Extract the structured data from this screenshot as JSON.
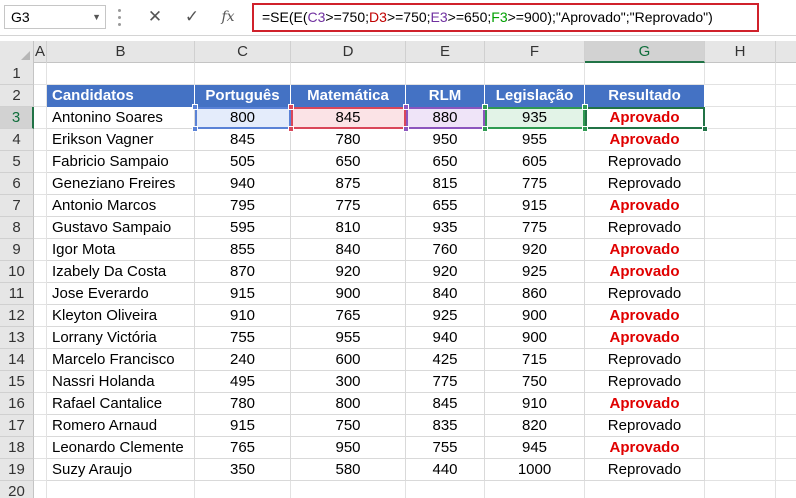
{
  "formula_bar": {
    "name_box": "G3",
    "cancel_icon": "✕",
    "enter_icon": "✓",
    "fx_label": "fx",
    "formula_parts": [
      {
        "text": "=SE(E(",
        "color": "#000000"
      },
      {
        "text": "C3",
        "color": "#7030a0"
      },
      {
        "text": ">=750;",
        "color": "#000000"
      },
      {
        "text": "D3",
        "color": "#c00000"
      },
      {
        "text": ">=750;",
        "color": "#000000"
      },
      {
        "text": "E3",
        "color": "#7030a0"
      },
      {
        "text": ">=650;",
        "color": "#000000"
      },
      {
        "text": "F3",
        "color": "#00a000"
      },
      {
        "text": ">=900);\"Aprovado\";\"Reprovado\")",
        "color": "#000000"
      }
    ]
  },
  "columns": [
    "A",
    "B",
    "C",
    "D",
    "E",
    "F",
    "G",
    "H"
  ],
  "rows": [
    "1",
    "2",
    "3",
    "4",
    "5",
    "6",
    "7",
    "8",
    "9",
    "10",
    "11",
    "12",
    "13",
    "14",
    "15",
    "16",
    "17",
    "18",
    "19",
    "20"
  ],
  "selected_cell": {
    "column": "G",
    "row": "3"
  },
  "table": {
    "headers": [
      "Candidatos",
      "Português",
      "Matemática",
      "RLM",
      "Legislação",
      "Resultado"
    ],
    "rows": [
      [
        "Antonino Soares",
        "800",
        "845",
        "880",
        "935",
        "Aprovado"
      ],
      [
        "Erikson Vagner",
        "845",
        "780",
        "950",
        "955",
        "Aprovado"
      ],
      [
        "Fabricio Sampaio",
        "505",
        "650",
        "650",
        "605",
        "Reprovado"
      ],
      [
        "Geneziano Freires",
        "940",
        "875",
        "815",
        "775",
        "Reprovado"
      ],
      [
        "Antonio Marcos",
        "795",
        "775",
        "655",
        "915",
        "Aprovado"
      ],
      [
        "Gustavo Sampaio",
        "595",
        "810",
        "935",
        "775",
        "Reprovado"
      ],
      [
        "Igor Mota",
        "855",
        "840",
        "760",
        "920",
        "Aprovado"
      ],
      [
        "Izabely Da Costa",
        "870",
        "920",
        "920",
        "925",
        "Aprovado"
      ],
      [
        "Jose Everardo",
        "915",
        "900",
        "840",
        "860",
        "Reprovado"
      ],
      [
        "Kleyton Oliveira",
        "910",
        "765",
        "925",
        "900",
        "Aprovado"
      ],
      [
        "Lorrany Victória",
        "755",
        "955",
        "940",
        "900",
        "Aprovado"
      ],
      [
        "Marcelo Francisco",
        "240",
        "600",
        "425",
        "715",
        "Reprovado"
      ],
      [
        "Nassri Holanda",
        "495",
        "300",
        "775",
        "750",
        "Reprovado"
      ],
      [
        "Rafael Cantalice",
        "780",
        "800",
        "845",
        "910",
        "Aprovado"
      ],
      [
        "Romero Arnaud",
        "915",
        "750",
        "835",
        "820",
        "Reprovado"
      ],
      [
        "Leonardo Clemente",
        "765",
        "950",
        "755",
        "945",
        "Aprovado"
      ],
      [
        "Suzy Araujo",
        "350",
        "580",
        "440",
        "1000",
        "Reprovado"
      ]
    ]
  },
  "colors": {
    "header_fill": "#4472c4",
    "approved_text": "#e00000",
    "selection": "#217346",
    "formula_box_border": "#d0212b"
  }
}
